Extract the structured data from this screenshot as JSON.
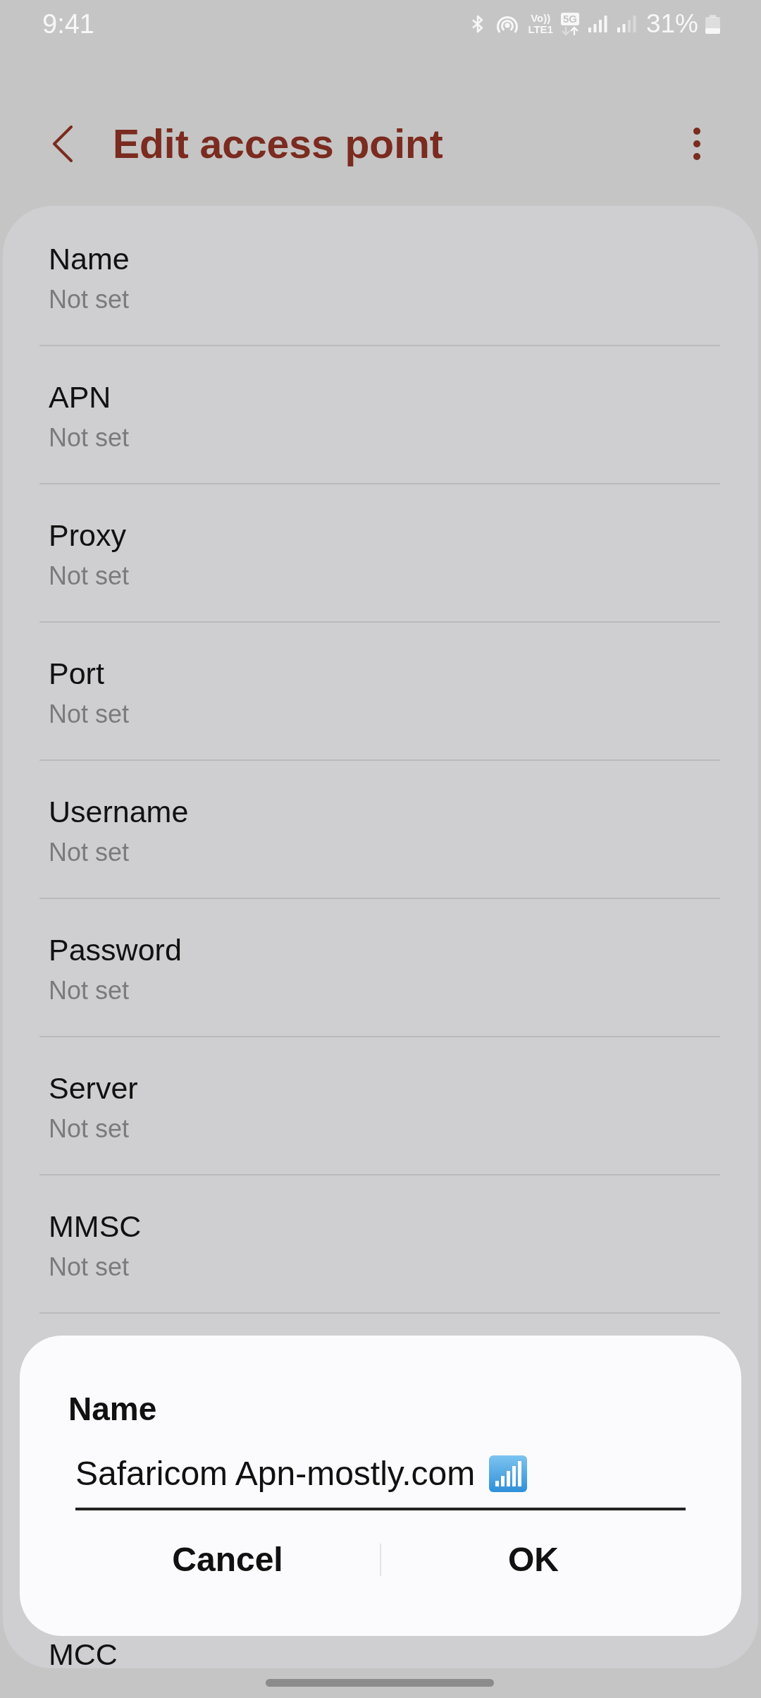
{
  "status_bar": {
    "time": "9:41",
    "icons": [
      {
        "kind": "bluetooth"
      },
      {
        "kind": "hotspot"
      },
      {
        "kind": "volte",
        "lines": [
          "Vo))",
          "LTE1"
        ]
      },
      {
        "kind": "network",
        "label": "5G"
      },
      {
        "kind": "signal_full"
      },
      {
        "kind": "signal_low"
      }
    ],
    "battery": "31%"
  },
  "header": {
    "title": "Edit access point"
  },
  "settings": [
    {
      "label": "Name",
      "value": "Not set"
    },
    {
      "label": "APN",
      "value": "Not set"
    },
    {
      "label": "Proxy",
      "value": "Not set"
    },
    {
      "label": "Port",
      "value": "Not set"
    },
    {
      "label": "Username",
      "value": "Not set"
    },
    {
      "label": "Password",
      "value": "Not set"
    },
    {
      "label": "Server",
      "value": "Not set"
    },
    {
      "label": "MMSC",
      "value": "Not set"
    }
  ],
  "partly_hidden_item": {
    "label": "MCC"
  },
  "dialog": {
    "title": "Name",
    "input": {
      "value": "Safaricom Apn-mostly.com"
    },
    "buttons": [
      "Cancel",
      "OK"
    ]
  }
}
